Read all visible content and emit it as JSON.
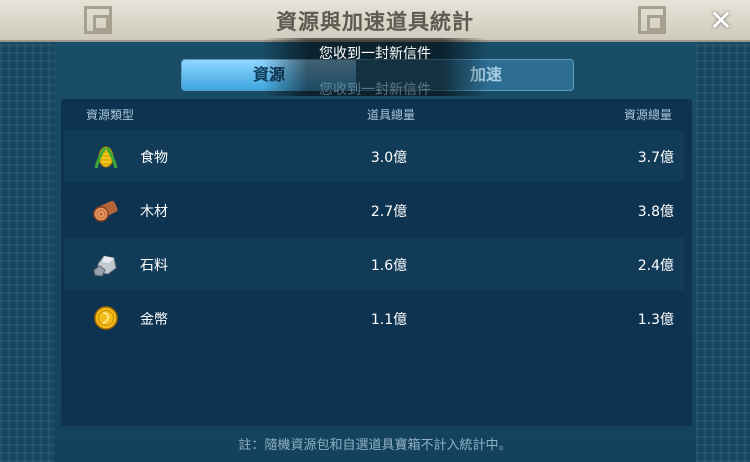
{
  "window": {
    "title": "資源與加速道具統計",
    "close_label": "✕"
  },
  "tabs": [
    {
      "label": "資源",
      "active": true
    },
    {
      "label": "加速",
      "active": false
    }
  ],
  "toast": {
    "message": "您收到一封新信件",
    "message_ghost": "您收到一封新信件"
  },
  "table": {
    "headers": {
      "type": "資源類型",
      "items": "道具總量",
      "total": "資源總量"
    },
    "rows": [
      {
        "icon": "corn-icon",
        "name": "食物",
        "items": "3.0億",
        "total": "3.7億"
      },
      {
        "icon": "log-icon",
        "name": "木材",
        "items": "2.7億",
        "total": "3.8億"
      },
      {
        "icon": "stone-icon",
        "name": "石料",
        "items": "1.6億",
        "total": "2.4億"
      },
      {
        "icon": "gold-coin-icon",
        "name": "金幣",
        "items": "1.1億",
        "total": "1.3億"
      }
    ]
  },
  "footnote": "註：隨機資源包和自選道具寶箱不計入統計中。"
}
